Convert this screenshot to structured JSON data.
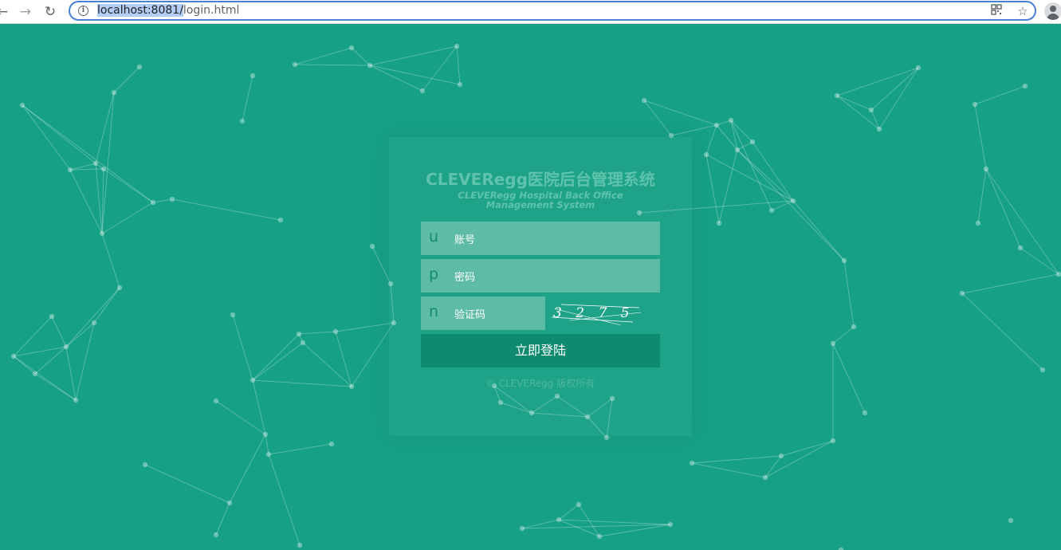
{
  "browser": {
    "url_host": "localhost:8081/",
    "url_path": "login.html"
  },
  "login": {
    "title": "CLEVERegg医院后台管理系统",
    "subtitle": "CLEVERegg Hospital Back Office Management System",
    "username": {
      "icon": "u",
      "placeholder": "账号"
    },
    "password": {
      "icon": "p",
      "placeholder": "密码"
    },
    "captcha": {
      "icon": "n",
      "placeholder": "验证码",
      "code": "3 2 7 5"
    },
    "submit_label": "立即登陆",
    "copyright": "© CLEVERegg 版权所有"
  },
  "colors": {
    "background": "#16a085",
    "field": "#5dbba6",
    "button": "#0e8a6e"
  }
}
